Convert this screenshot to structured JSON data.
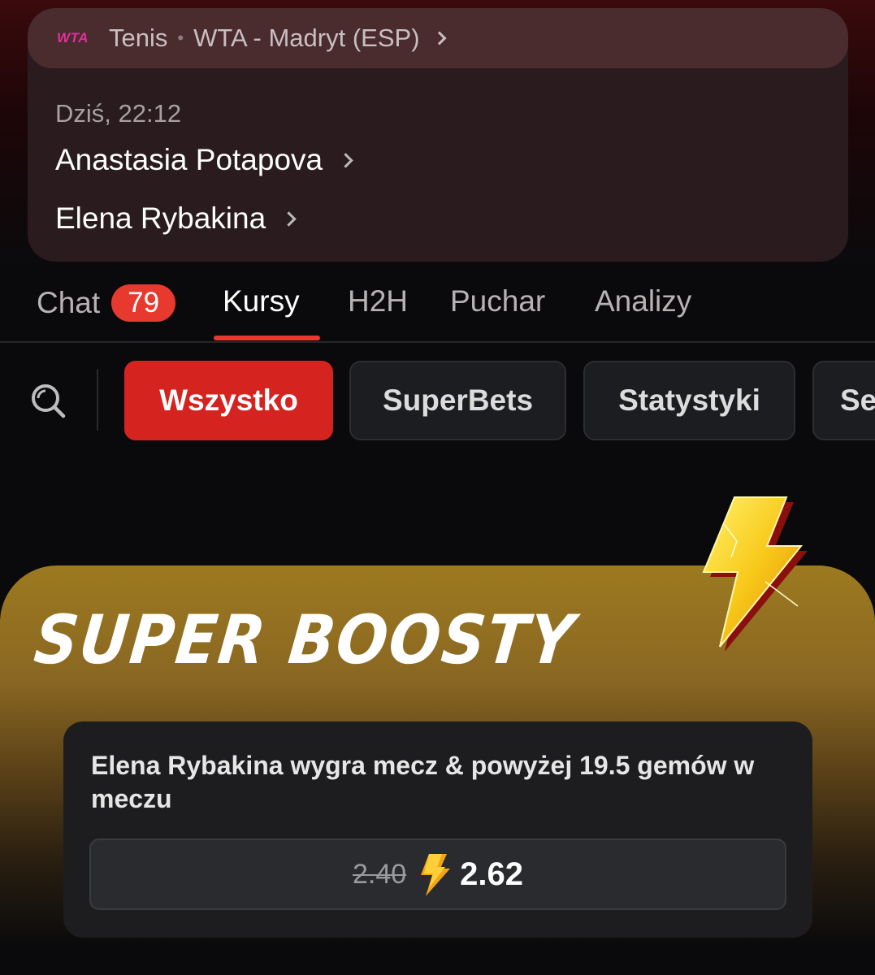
{
  "match": {
    "league_logo": "WTA",
    "sport": "Tenis",
    "separator": "•",
    "league": "WTA - Madryt (ESP)",
    "time": "Dziś, 22:12",
    "player1": "Anastasia Potapova",
    "player2": "Elena Rybakina"
  },
  "tabs": [
    {
      "label": "Chat",
      "badge": "79"
    },
    {
      "label": "Kursy",
      "active": true
    },
    {
      "label": "H2H"
    },
    {
      "label": "Puchar"
    },
    {
      "label": "Analizy"
    }
  ],
  "filters": {
    "search_icon": "search-icon",
    "chips": [
      "Wszystko",
      "SuperBets",
      "Statystyki",
      "Se"
    ]
  },
  "boost": {
    "title": "SUPER BOOSTY",
    "bet_description": "Elena Rybakina wygra mecz & powyżej 19.5 gemów w meczu",
    "old_odds": "2.40",
    "new_odds": "2.62"
  },
  "colors": {
    "accent_red": "#e8392f",
    "active_chip": "#d52420",
    "boost_gold": "#9c7a20",
    "wta_pink": "#e0309a"
  }
}
